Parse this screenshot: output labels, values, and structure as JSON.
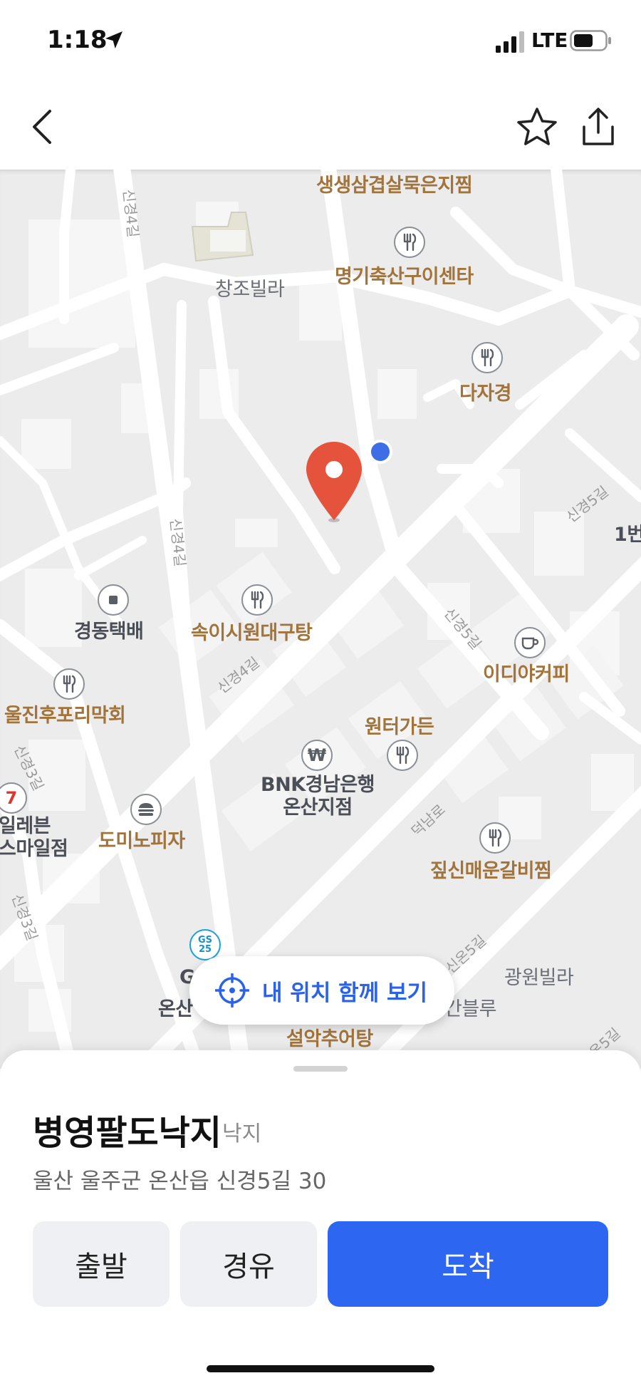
{
  "status_bar": {
    "time": "1:18",
    "network": "LTE"
  },
  "map": {
    "pois": {
      "p1": "생생삼겹살묵은지찜",
      "p2": "명기축산구이센타",
      "p3": "창조빌라",
      "p4": "다자경",
      "p5": "1번",
      "p6": "경동택배",
      "p7": "속이시원대구탕",
      "p8": "이디야커피",
      "p9": "울진후포리막회",
      "p10": "원터가든",
      "p11_line1": "BNK경남은행",
      "p11_line2": "온산지점",
      "p12_line1": "일레븐",
      "p12_line2": "스마일점",
      "p13": "도미노피자",
      "p14": "짚신매운갈비찜",
      "p15": "광원빌라",
      "p16": "간블루",
      "p17": "설악추어탕",
      "p18_a": "G",
      "p18_b": "온산"
    },
    "roads": {
      "r1": "신경4길",
      "r2": "신경4길",
      "r3": "신경4길",
      "r4": "신경5길",
      "r5": "신경5길",
      "r6": "신경3길",
      "r7": "신경3길",
      "r8": "덕남로",
      "r9": "신온5길",
      "r10": "온5길"
    },
    "gs_logo": "GS\n25",
    "locate_button": "내 위치 함께 보기",
    "accent_marker": "#e5533c",
    "accent_location": "#3d6ee8"
  },
  "place": {
    "name": "병영팔도낙지",
    "category": "낙지",
    "address": "울산 울주군 온산읍 신경5길 30"
  },
  "actions": {
    "start": "출발",
    "via": "경유",
    "destination": "도착"
  },
  "colors": {
    "primary": "#2d66f0",
    "poi_text": "#a0743c"
  }
}
